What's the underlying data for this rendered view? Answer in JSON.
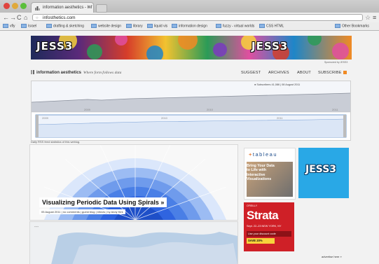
{
  "browser": {
    "tab_title": "information aesthetics - Inf",
    "tab_close": "×",
    "url": "infosthetics.com",
    "nav": {
      "back": "←",
      "forward": "→",
      "reload": "C",
      "home": "⌂"
    },
    "star": "☆",
    "wrench": "🔧",
    "bookmarks": [
      "vfly",
      "Israel",
      "drafting & sketching",
      "website design",
      "library",
      "liquid vis",
      "information design",
      "fuzzy - virtual worlds",
      "CSS HTML"
    ],
    "other_bookmarks": "Other Bookmarks"
  },
  "banner": {
    "logo_left": "JESS3",
    "logo_right": "JESS3",
    "sponsored": "Sponsored by JESS3"
  },
  "site": {
    "name": "information aesthetics",
    "tagline": "Where form follows data",
    "nav": [
      "SUGGEST",
      "ARCHIVES",
      "ABOUT",
      "SUBSCRIBE"
    ]
  },
  "graph": {
    "header": "● Subscribers 41,086 | 08 August 2011",
    "top_years": [
      "2009",
      "2010",
      "2011"
    ],
    "bottom_years": [
      "2009",
      "2010",
      "2011"
    ],
    "note": "Daily RSS feed statistics of this weblog."
  },
  "article": {
    "headline": "Visualizing Periodic Data Using Spirals »",
    "byline": "05 August 2011 | no comments | guest blog | infovis | by Andy Kirk"
  },
  "ads": {
    "tableau_logo": "tableau",
    "tableau_text": "Bring Your Data to Life with Interactive Visualizations",
    "jess3_logo": "JESS3",
    "strata_small": "O'REILLY",
    "strata_title": "Strata",
    "strata_dates": "Sept. 22–23 NEW YORK, NY",
    "strata_use": "Use your discount code",
    "strata_save": "SAVE 20%",
    "advertise": "advertise here »"
  },
  "colors": {
    "accent_blue": "#2f64e0",
    "strata_red": "#cf2027",
    "jess3_blue": "#29a8e6"
  }
}
